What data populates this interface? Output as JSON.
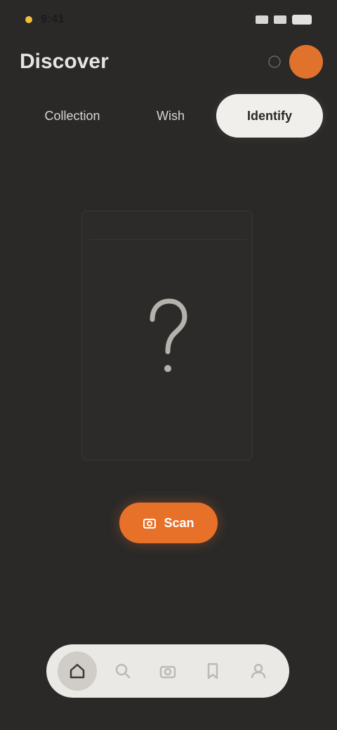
{
  "status_bar": {
    "time": "9:41"
  },
  "header": {
    "title": "Discover",
    "avatar_initial": ""
  },
  "tabs": [
    {
      "label": "Collection"
    },
    {
      "label": "Wish"
    },
    {
      "label": "Identify"
    }
  ],
  "card": {
    "title": ""
  },
  "scan_button": {
    "label": "Scan"
  },
  "helper_text": "",
  "bottom_nav": {
    "items": [
      {
        "icon": "home-icon",
        "active": true
      },
      {
        "icon": "search-icon",
        "active": false
      },
      {
        "icon": "camera-icon",
        "active": false
      },
      {
        "icon": "bookmark-icon",
        "active": false
      },
      {
        "icon": "profile-icon",
        "active": false
      }
    ]
  },
  "colors": {
    "background": "#2a2928",
    "accent": "#e8712a",
    "active_tab": "#f1efec",
    "bottom_nav": "#ebe9e6"
  }
}
